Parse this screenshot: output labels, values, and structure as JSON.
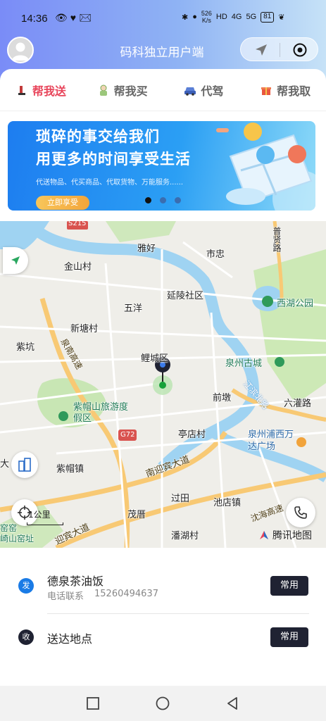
{
  "status": {
    "time": "14:36",
    "speed_top": "526",
    "speed_unit": "K/s",
    "net1": "4G",
    "net2": "5G",
    "battery": "81"
  },
  "header": {
    "title": "码科独立用户端"
  },
  "tabs": [
    {
      "label": "帮我送",
      "active": true,
      "icon": "delivery-icon"
    },
    {
      "label": "帮我买",
      "active": false,
      "icon": "shopper-icon"
    },
    {
      "label": "代驾",
      "active": false,
      "icon": "car-icon"
    },
    {
      "label": "帮我取",
      "active": false,
      "icon": "gift-icon"
    }
  ],
  "banner": {
    "line1": "琐碎的事交给我们",
    "line2": "用更多的时间享受生活",
    "subtitle": "代送物品、代买商品、代取货物、万能服务......",
    "cta": "立即享受",
    "active_slide": 1,
    "slide_count": 3
  },
  "map": {
    "places": {
      "s215": "S215",
      "yahao": "雅好",
      "shizhong": "市忠",
      "puxianlu": "普贤路",
      "jinshancun": "金山村",
      "yanlingshequ": "延陵社区",
      "xihugongyuan": "西湖公园",
      "wuyang": "五洋",
      "xintangcun": "新塘村",
      "zikeng": "紫坑",
      "quannanlu": "泉南高速",
      "lichengqu": "鲤城区",
      "quanzhougucheng": "泉州古城",
      "qiandun": "前墩",
      "jiangbinbeilu": "江滨北路",
      "liuguanlu": "六灌路",
      "zimaoshan": "紫帽山旅游度假区",
      "g72": "G72",
      "tingdiancun": "亭店村",
      "wanda": "泉州浦西万达广场",
      "zimaozhen": "紫帽镇",
      "nanyingbin": "南迎宾大道",
      "guotian": "过田",
      "chidianzhen": "池店镇",
      "maoxuan": "茂厝",
      "panhucun": "潘湖村",
      "yanhai": "沈海高速",
      "yingbin2": "迎宾大道",
      "yaozhi": "窑窑",
      "qishan": "崎山窑址",
      "da": "大"
    },
    "scale_label": "1公里",
    "provider": "腾讯地图"
  },
  "sender": {
    "badge": "发",
    "name": "德泉茶油饭",
    "phone_label": "电话联系",
    "phone": "15260494637",
    "button": "常用"
  },
  "receiver": {
    "badge": "收",
    "name": "送达地点",
    "button": "常用"
  },
  "colors": {
    "accent_red": "#e8455b",
    "badge_blue": "#1a7be6",
    "dark_button": "#1f2232"
  }
}
